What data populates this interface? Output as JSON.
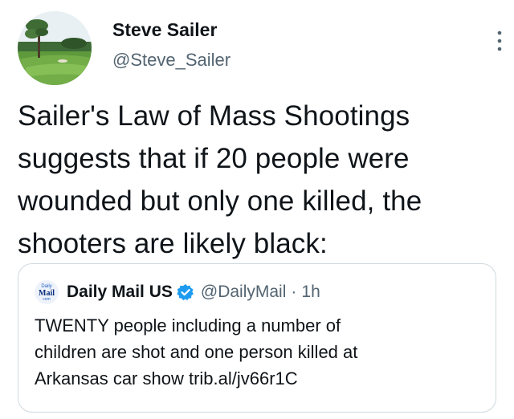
{
  "author": {
    "display_name": "Steve Sailer",
    "handle": "@Steve_Sailer",
    "avatar_icon": "golf-course-avatar"
  },
  "tweet": {
    "text": "Sailer's Law of Mass Shootings\nsuggests that if 20 people were\nwounded but only one killed, the\nshooters are likely black:"
  },
  "quoted_tweet": {
    "avatar_text_1": "Daily",
    "avatar_text_2": "Mail",
    "avatar_text_3": "com",
    "display_name": "Daily Mail US",
    "verified_icon": "verified-badge-icon",
    "handle": "@DailyMail",
    "separator": "·",
    "time": "1h",
    "text": "TWENTY people including a number of\nchildren are shot and one person killed at\nArkansas car show  trib.al/jv66r1C"
  },
  "colors": {
    "text_primary": "#0f1419",
    "text_secondary": "#536471",
    "verified_blue": "#1d9bf0",
    "border": "#cfd9de"
  },
  "icons": {
    "more": "more-vertical-icon"
  }
}
